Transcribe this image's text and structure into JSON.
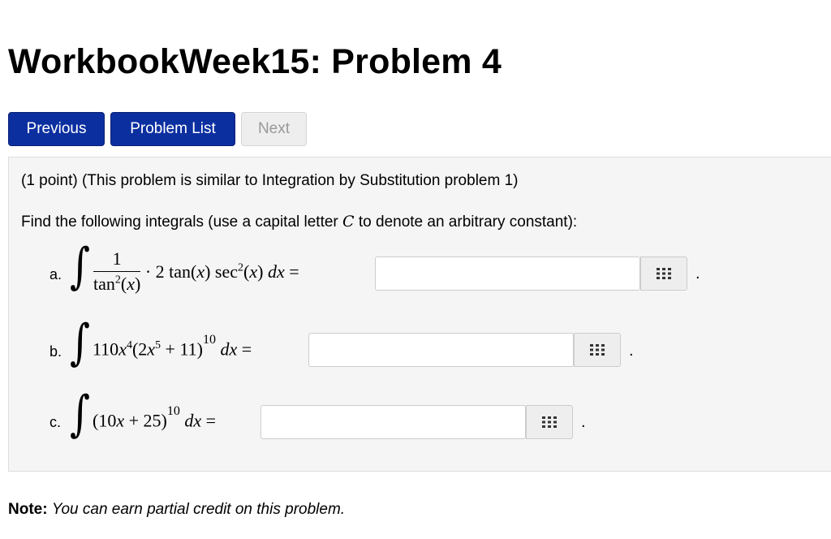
{
  "page_title": "WorkbookWeek15: Problem 4",
  "nav": {
    "previous": "Previous",
    "problem_list": "Problem List",
    "next": "Next"
  },
  "problem": {
    "header": "(1 point) (This problem is similar to Integration by Substitution problem 1)",
    "instructions_prefix": "Find the following integrals (use a capital letter ",
    "instructions_var": "C",
    "instructions_suffix": " to denote an arbitrary constant):",
    "parts": [
      {
        "label": "a.",
        "answer": "",
        "end": "."
      },
      {
        "label": "b.",
        "answer": "",
        "end": "."
      },
      {
        "label": "c.",
        "answer": "",
        "end": "."
      }
    ]
  },
  "note": {
    "label": "Note:",
    "text": "You can earn partial credit on this problem."
  },
  "icons": {
    "equation_editor": "grid-icon"
  }
}
